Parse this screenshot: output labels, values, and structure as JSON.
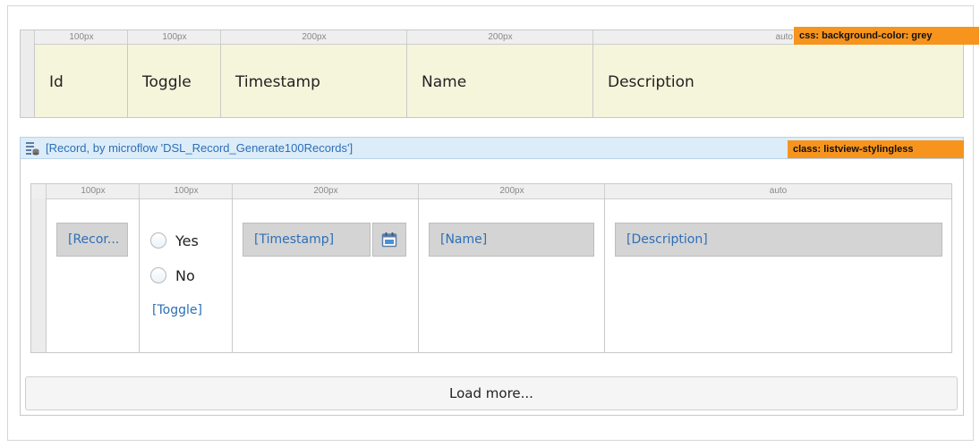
{
  "header_table": {
    "ruler": [
      "100px",
      "100px",
      "200px",
      "200px",
      "auto"
    ],
    "columns": [
      "Id",
      "Toggle",
      "Timestamp",
      "Name",
      "Description"
    ],
    "background": "#f5f5dc",
    "css_tag": "css: background-color: grey"
  },
  "listview": {
    "title": "[Record, by microflow 'DSL_Record_Generate100Records']",
    "class_tag": "class: listview-stylingless",
    "header_color": "#dcecf8",
    "ruler": [
      "100px",
      "100px",
      "200px",
      "200px",
      "auto"
    ],
    "fields": {
      "id": "[Recor...",
      "timestamp": "[Timestamp]",
      "name": "[Name]",
      "description": "[Description]"
    },
    "toggle": {
      "yes_label": "Yes",
      "no_label": "No",
      "caption": "[Toggle]"
    },
    "load_more_label": "Load more..."
  },
  "colors": {
    "tag_orange": "#f7941d",
    "link_blue": "#2d6fb7"
  }
}
